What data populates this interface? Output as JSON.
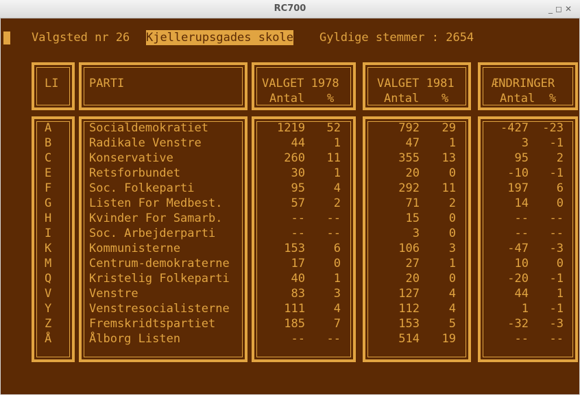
{
  "window": {
    "title": "RC700",
    "controls": {
      "minimize": "_",
      "maximize": "◻",
      "close": "✕"
    }
  },
  "header": {
    "station_label": "Valgsted nr 26",
    "station_name": "Kjellerupsgades skole",
    "votes_label": "Gyldige stemmer : 2654"
  },
  "columns": {
    "li": "LI",
    "parti": "PARTI",
    "v1978": "VALGET 1978",
    "v1981": "VALGET 1981",
    "change": "ÆNDRINGER",
    "antal": "Antal",
    "pct": "%"
  },
  "rows": [
    {
      "li": "A",
      "party": "Socialdemokratiet",
      "a78": "1219",
      "p78": "52",
      "a81": "792",
      "p81": "29",
      "ca": "-427",
      "cp": "-23"
    },
    {
      "li": "B",
      "party": "Radikale Venstre",
      "a78": "44",
      "p78": "1",
      "a81": "47",
      "p81": "1",
      "ca": "3",
      "cp": "-1"
    },
    {
      "li": "C",
      "party": "Konservative",
      "a78": "260",
      "p78": "11",
      "a81": "355",
      "p81": "13",
      "ca": "95",
      "cp": "2"
    },
    {
      "li": "E",
      "party": "Retsforbundet",
      "a78": "30",
      "p78": "1",
      "a81": "20",
      "p81": "0",
      "ca": "-10",
      "cp": "-1"
    },
    {
      "li": "F",
      "party": "Soc. Folkeparti",
      "a78": "95",
      "p78": "4",
      "a81": "292",
      "p81": "11",
      "ca": "197",
      "cp": "6"
    },
    {
      "li": "G",
      "party": "Listen For Medbest.",
      "a78": "57",
      "p78": "2",
      "a81": "71",
      "p81": "2",
      "ca": "14",
      "cp": "0"
    },
    {
      "li": "H",
      "party": "Kvinder For Samarb.",
      "a78": "--",
      "p78": "--",
      "a81": "15",
      "p81": "0",
      "ca": "--",
      "cp": "--"
    },
    {
      "li": "I",
      "party": "Soc. Arbejderparti",
      "a78": "--",
      "p78": "--",
      "a81": "3",
      "p81": "0",
      "ca": "--",
      "cp": "--"
    },
    {
      "li": "K",
      "party": "Kommunisterne",
      "a78": "153",
      "p78": "6",
      "a81": "106",
      "p81": "3",
      "ca": "-47",
      "cp": "-3"
    },
    {
      "li": "M",
      "party": "Centrum-demokraterne",
      "a78": "17",
      "p78": "0",
      "a81": "27",
      "p81": "1",
      "ca": "10",
      "cp": "0"
    },
    {
      "li": "Q",
      "party": "Kristelig Folkeparti",
      "a78": "40",
      "p78": "1",
      "a81": "20",
      "p81": "0",
      "ca": "-20",
      "cp": "-1"
    },
    {
      "li": "V",
      "party": "Venstre",
      "a78": "83",
      "p78": "3",
      "a81": "127",
      "p81": "4",
      "ca": "44",
      "cp": "1"
    },
    {
      "li": "Y",
      "party": "Venstresocialisterne",
      "a78": "111",
      "p78": "4",
      "a81": "112",
      "p81": "4",
      "ca": "1",
      "cp": "-1"
    },
    {
      "li": "Z",
      "party": "Fremskridtspartiet",
      "a78": "185",
      "p78": "7",
      "a81": "153",
      "p81": "5",
      "ca": "-32",
      "cp": "-3"
    },
    {
      "li": "Å",
      "party": "Ålborg Listen",
      "a78": "--",
      "p78": "--",
      "a81": "514",
      "p81": "19",
      "ca": "--",
      "cp": "--"
    }
  ]
}
